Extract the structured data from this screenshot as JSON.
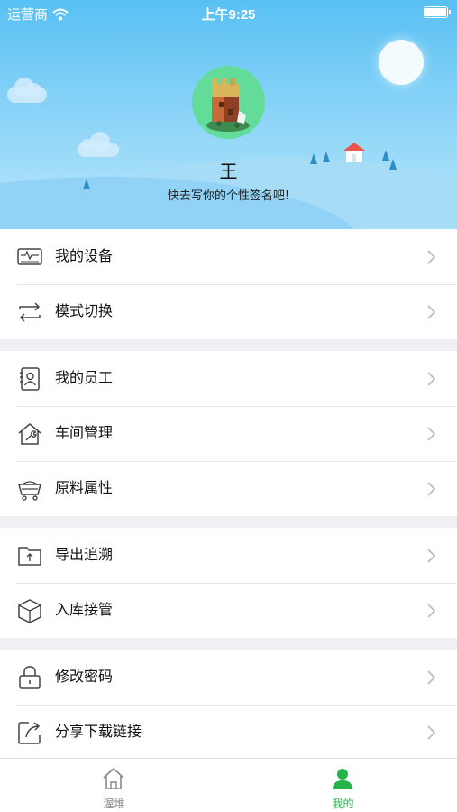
{
  "status_bar": {
    "carrier": "运营商",
    "time": "上午9:25"
  },
  "profile": {
    "name": "王",
    "signature": "快去写你的个性签名吧!"
  },
  "menu": {
    "group1": [
      {
        "label": "我的设备",
        "icon": "device-monitor-icon"
      },
      {
        "label": "模式切换",
        "icon": "switch-arrows-icon"
      }
    ],
    "group2": [
      {
        "label": "我的员工",
        "icon": "staff-contact-icon"
      },
      {
        "label": "车间管理",
        "icon": "workshop-wrench-icon"
      },
      {
        "label": "原料属性",
        "icon": "cart-icon"
      }
    ],
    "group3": [
      {
        "label": "导出追溯",
        "icon": "folder-upload-icon"
      },
      {
        "label": "入库接管",
        "icon": "box-icon"
      }
    ],
    "group4": [
      {
        "label": "修改密码",
        "icon": "lock-icon"
      },
      {
        "label": "分享下载链接",
        "icon": "share-icon"
      }
    ]
  },
  "tabbar": {
    "home_label": "渥堆",
    "me_label": "我的",
    "active_color": "#27b34a",
    "inactive_color": "#888888"
  }
}
